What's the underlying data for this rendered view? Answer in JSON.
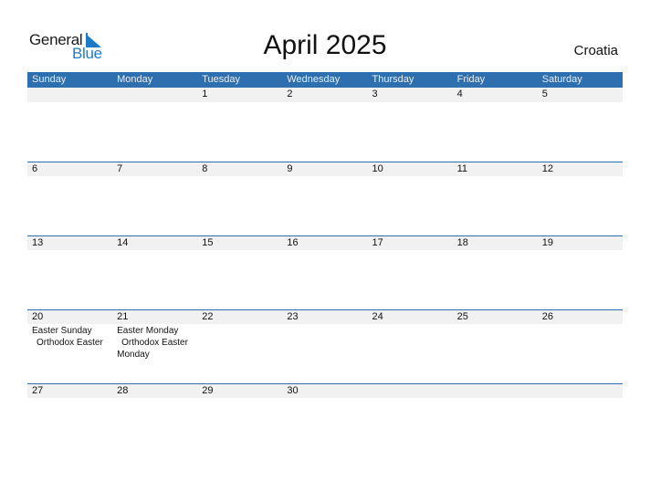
{
  "logo": {
    "line1": "General",
    "line2": "Blue"
  },
  "title": "April 2025",
  "country": "Croatia",
  "weekdays": [
    "Sunday",
    "Monday",
    "Tuesday",
    "Wednesday",
    "Thursday",
    "Friday",
    "Saturday"
  ],
  "weeks": [
    {
      "days": [
        "",
        "",
        "1",
        "2",
        "3",
        "4",
        "5"
      ]
    },
    {
      "days": [
        "6",
        "7",
        "8",
        "9",
        "10",
        "11",
        "12"
      ]
    },
    {
      "days": [
        "13",
        "14",
        "15",
        "16",
        "17",
        "18",
        "19"
      ]
    },
    {
      "days": [
        "20",
        "21",
        "22",
        "23",
        "24",
        "25",
        "26"
      ],
      "events": {
        "sun": [
          "Easter Sunday",
          "Orthodox Easter"
        ],
        "mon": [
          "Easter Monday",
          "Orthodox Easter",
          "Monday"
        ]
      }
    },
    {
      "days": [
        "27",
        "28",
        "29",
        "30",
        "",
        "",
        ""
      ]
    }
  ],
  "colors": {
    "header": "#2e6fb0",
    "datebar": "#f1f1f1",
    "brand_blue": "#1d7bc8"
  }
}
